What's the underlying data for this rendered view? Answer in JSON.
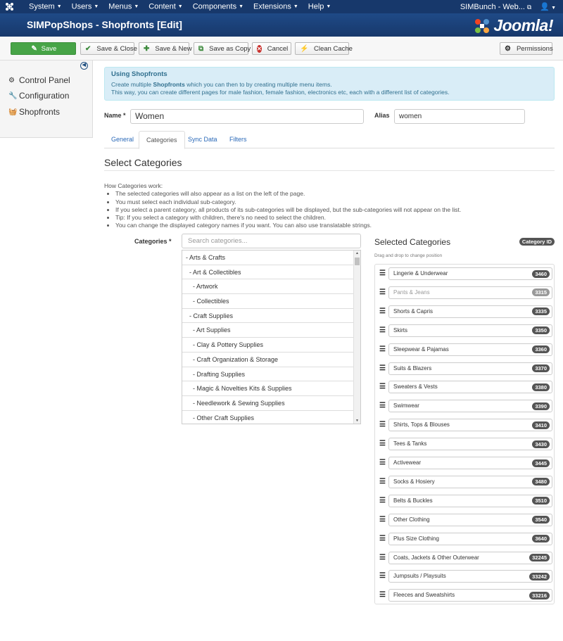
{
  "topnav": {
    "logo_icon": "joomla-icon",
    "menu": [
      {
        "label": "System"
      },
      {
        "label": "Users"
      },
      {
        "label": "Menus"
      },
      {
        "label": "Content"
      },
      {
        "label": "Components"
      },
      {
        "label": "Extensions"
      },
      {
        "label": "Help"
      }
    ],
    "site_link": "SIMBunch - Web...",
    "user_icon": "user-icon"
  },
  "header": {
    "title": "SIMPopShops - Shopfronts [Edit]",
    "brand": "Joomla!"
  },
  "toolbar": {
    "save": "Save",
    "save_close": "Save & Close",
    "save_new": "Save & New",
    "save_copy": "Save as Copy",
    "cancel": "Cancel",
    "clean_cache": "Clean Cache",
    "permissions": "Permissions"
  },
  "sidebar": {
    "items": [
      {
        "label": "Control Panel",
        "icon": "cogs-icon"
      },
      {
        "label": "Configuration",
        "icon": "wrench-icon"
      },
      {
        "label": "Shopfronts",
        "icon": "basket-icon"
      }
    ]
  },
  "alert": {
    "heading": "Using Shopfronts",
    "line1_pre": "Create multiple ",
    "line1_bold": "Shopfronts",
    "line1_post": " which you can then to by creating multiple menu items.",
    "line2": "This way, you can create different pages for male fashion, female fashion, electronics etc, each with a different list of categories."
  },
  "form": {
    "name_label": "Name *",
    "name_value": "Women",
    "alias_label": "Alias",
    "alias_value": "women"
  },
  "tabs": [
    {
      "label": "General"
    },
    {
      "label": "Categories"
    },
    {
      "label": "Sync Data"
    },
    {
      "label": "Filters"
    }
  ],
  "section_title": "Select Categories",
  "howto": {
    "heading": "How Categories work:",
    "items": [
      "The selected categories will also appear as a list on the left of the page.",
      "You must select each individual sub-category.",
      "If you select a parent category, all products of its sub-categories will be displayed, but the sub-categories will not appear on the list.",
      "Tip: If you select a category with children, there's no need to select the children.",
      "You can change the displayed category names if you want. You can also use translatable strings."
    ]
  },
  "categories": {
    "label": "Categories *",
    "search_placeholder": "Search categories...",
    "list": [
      "- Arts & Crafts",
      "- Art & Collectibles",
      "- Artwork",
      "- Collectibles",
      "- Craft Supplies",
      "- Art Supplies",
      "- Clay & Pottery Supplies",
      "- Craft Organization & Storage",
      "- Drafting Supplies",
      "- Magic & Novelties Kits & Supplies",
      "- Needlework & Sewing Supplies",
      "- Other Craft Supplies"
    ]
  },
  "selected": {
    "title": "Selected Categories",
    "badge": "Category ID",
    "hint": "Drag and drop to change position",
    "items": [
      {
        "name": "Lingerie & Underwear",
        "id": "3460"
      },
      {
        "name": "Pants & Jeans",
        "id": "3315"
      },
      {
        "name": "Shorts & Capris",
        "id": "3335"
      },
      {
        "name": "Skirts",
        "id": "3350"
      },
      {
        "name": "Sleepwear & Pajamas",
        "id": "3360"
      },
      {
        "name": "Suits & Blazers",
        "id": "3370"
      },
      {
        "name": "Sweaters & Vests",
        "id": "3380"
      },
      {
        "name": "Swimwear",
        "id": "3390"
      },
      {
        "name": "Shirts, Tops & Blouses",
        "id": "3410"
      },
      {
        "name": "Tees & Tanks",
        "id": "3430"
      },
      {
        "name": "Activewear",
        "id": "3445"
      },
      {
        "name": "Socks & Hosiery",
        "id": "3480"
      },
      {
        "name": "Belts & Buckles",
        "id": "3510"
      },
      {
        "name": "Other Clothing",
        "id": "3540"
      },
      {
        "name": "Plus Size Clothing",
        "id": "3640"
      },
      {
        "name": "Coats, Jackets & Other Outerwear",
        "id": "32245"
      },
      {
        "name": "Jumpsuits / Playsuits",
        "id": "33242"
      },
      {
        "name": "Fleeces and Sweatshirts",
        "id": "33216"
      }
    ]
  },
  "colors": {
    "navbar": "#17386b",
    "save_button": "#47a447",
    "alert_bg": "#d9edf7",
    "badge": "#555555"
  }
}
